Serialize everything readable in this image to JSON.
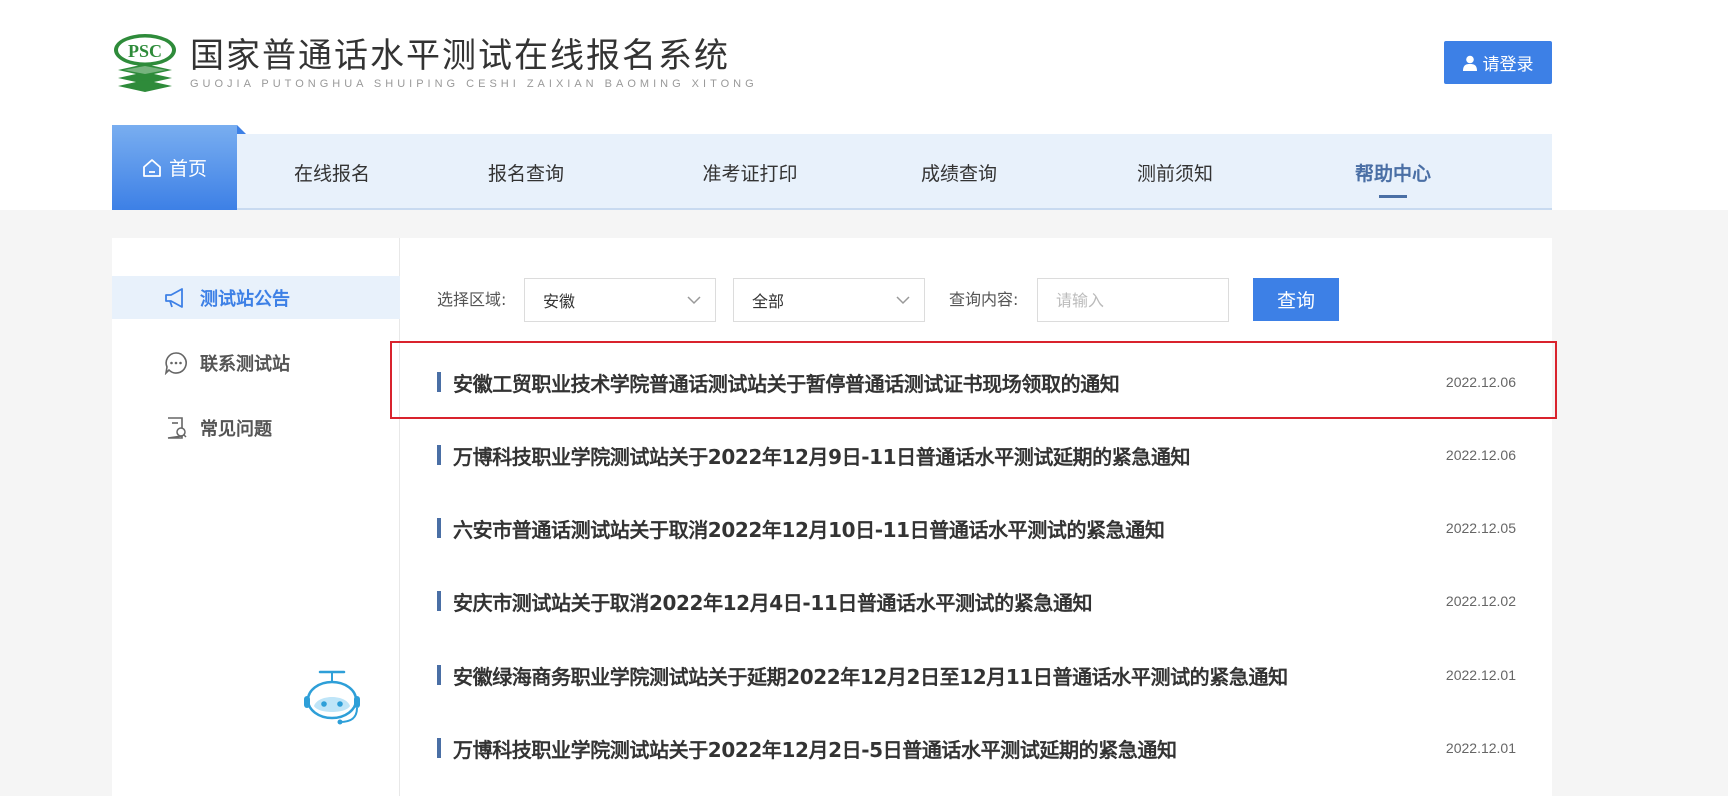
{
  "header": {
    "logo_badge": "PSC",
    "title": "国家普通话水平测试在线报名系统",
    "subtitle": "GUOJIA PUTONGHUA SHUIPING CESHI ZAIXIAN BAOMING XITONG",
    "login_label": "请登录"
  },
  "nav": {
    "home": "首页",
    "items": [
      {
        "label": "在线报名"
      },
      {
        "label": "报名查询"
      },
      {
        "label": "准考证打印"
      },
      {
        "label": "成绩查询"
      },
      {
        "label": "测前须知"
      },
      {
        "label": "帮助中心",
        "active": true
      }
    ]
  },
  "sidebar": {
    "items": [
      {
        "label": "测试站公告",
        "icon": "megaphone-icon",
        "active": true
      },
      {
        "label": "联系测试站",
        "icon": "chat-bubble-icon"
      },
      {
        "label": "常见问题",
        "icon": "document-question-icon"
      }
    ]
  },
  "filter": {
    "region_label": "选择区域:",
    "region_value": "安徽",
    "category_value": "全部",
    "query_label": "查询内容:",
    "query_placeholder": "请输入",
    "query_button": "查询"
  },
  "notices": [
    {
      "title": "安徽工贸职业技术学院普通话测试站关于暂停普通话测试证书现场领取的通知",
      "date": "2022.12.06",
      "highlighted": true
    },
    {
      "title": "万博科技职业学院测试站关于2022年12月9日-11日普通话水平测试延期的紧急通知",
      "date": "2022.12.06"
    },
    {
      "title": "六安市普通话测试站关于取消2022年12月10日-11日普通话水平测试的紧急通知",
      "date": "2022.12.05"
    },
    {
      "title": "安庆市测试站关于取消2022年12月4日-11日普通话水平测试的紧急通知",
      "date": "2022.12.02"
    },
    {
      "title": "安徽绿海商务职业学院测试站关于延期2022年12月2日至12月11日普通话水平测试的紧急通知",
      "date": "2022.12.01"
    },
    {
      "title": "万博科技职业学院测试站关于2022年12月2日-5日普通话水平测试延期的紧急通知",
      "date": "2022.12.01"
    }
  ],
  "colors": {
    "primary": "#3d80e6",
    "nav_bg": "#e8f1fb",
    "nav_active": "#4a6fa5",
    "logo_green": "#2e8b3a",
    "highlight_border": "#d9232d"
  }
}
